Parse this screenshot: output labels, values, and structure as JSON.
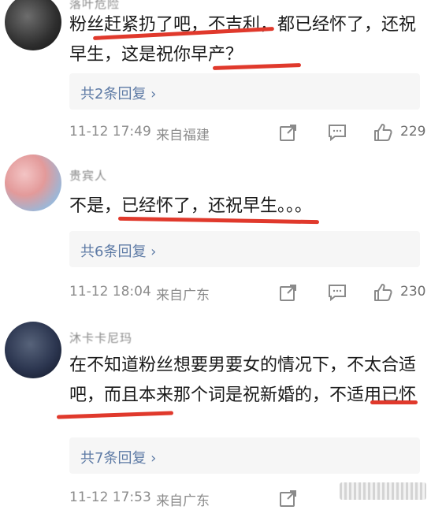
{
  "comments": [
    {
      "username": "落叶危险",
      "text": "粉丝赶紧扔了吧，不吉利，都已经怀了，还祝早生，这是祝你早产？",
      "reply_label": "共2条回复 ›",
      "time": "11-12 17:49",
      "location": "来自福建",
      "likes": "229"
    },
    {
      "username": "贵宾人",
      "text": "不是，已经怀了，还祝早生。。。",
      "reply_label": "共6条回复 ›",
      "time": "11-12 18:04",
      "location": "来自广东",
      "likes": "230"
    },
    {
      "username": "沐卡卡尼玛",
      "text": "在不知道粉丝想要男要女的情况下，不太合适吧，而且本来那个词是祝新婚的，不适用已怀",
      "reply_label": "共7条回复 ›",
      "time": "11-12 17:53",
      "location": "来自广东",
      "likes": ""
    }
  ],
  "icons": [
    "share-icon",
    "comment-icon",
    "thumb-up-icon"
  ],
  "colors": {
    "accent_link": "#5d7aa5",
    "highlight_mark": "#e0392c",
    "meta": "#8c8c8c"
  }
}
